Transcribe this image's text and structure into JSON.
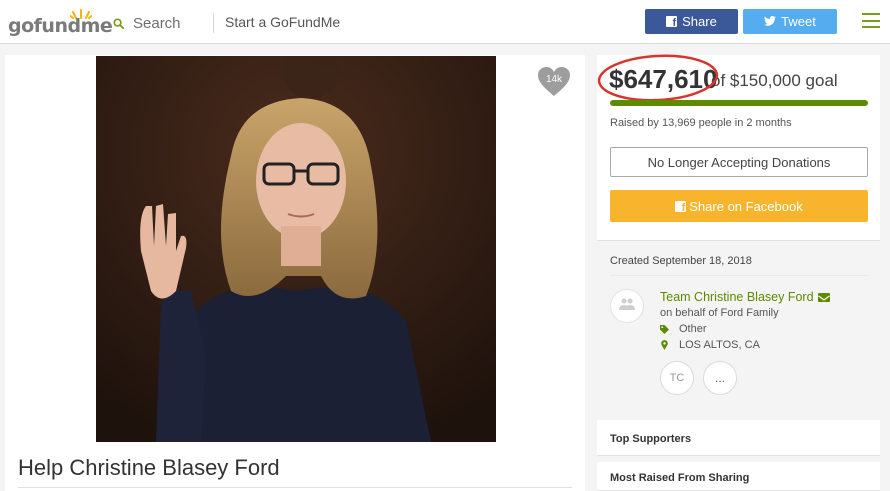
{
  "header": {
    "logo": "gofundme",
    "search_label": "Search",
    "start_label": "Start a GoFundMe",
    "share_label": "Share",
    "tweet_label": "Tweet"
  },
  "campaign": {
    "title": "Help Christine Blasey Ford",
    "heart_count": "14k",
    "raised_amount": "$647,610",
    "goal_text": "of $150,000 goal",
    "progress_fraction": 1.0,
    "raised_by": "Raised by 13,969 people in 2 months",
    "no_longer_label": "No Longer Accepting Donations",
    "share_facebook_label": "Share on Facebook",
    "created": "Created September 18, 2018"
  },
  "organizer": {
    "name": "Team Christine Blasey Ford",
    "behalf": "on behalf of Ford Family",
    "category": "Other",
    "location": "LOS ALTOS, CA",
    "initials": "TC",
    "more_label": "..."
  },
  "sections": {
    "top_supporters": "Top Supporters",
    "most_raised": "Most Raised From Sharing"
  },
  "colors": {
    "brand_green": "#5c8a00",
    "facebook_blue": "#3b5998",
    "twitter_blue": "#55acee",
    "share_orange": "#f8b42d",
    "highlight_red": "#d9342b"
  },
  "icons": [
    "search-icon",
    "facebook-icon",
    "twitter-icon",
    "menu-icon",
    "heart-icon",
    "mail-icon",
    "tag-icon",
    "map-pin-icon",
    "people-icon"
  ]
}
